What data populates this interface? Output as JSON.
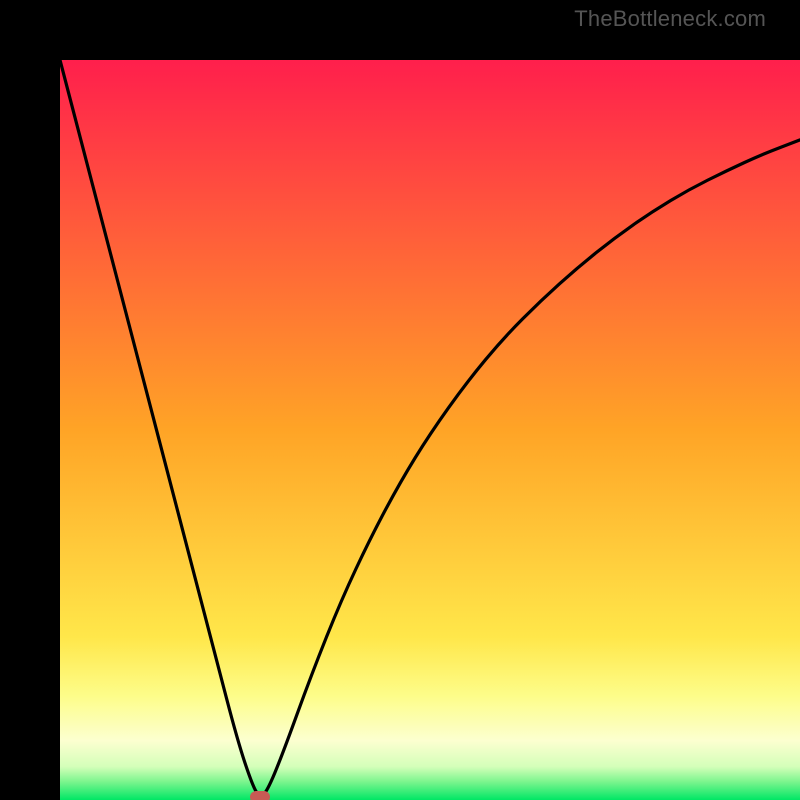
{
  "watermark": {
    "text": "TheBottleneck.com"
  },
  "chart_data": {
    "type": "line",
    "title": "",
    "xlabel": "",
    "ylabel": "",
    "xlim": [
      0,
      100
    ],
    "ylim": [
      0,
      100
    ],
    "grid": false,
    "legend": false,
    "background_gradient": {
      "stops": [
        {
          "pos": 0.0,
          "color": "#ff1f4c"
        },
        {
          "pos": 0.5,
          "color": "#ffa426"
        },
        {
          "pos": 0.78,
          "color": "#ffe74a"
        },
        {
          "pos": 0.86,
          "color": "#fdfd8a"
        },
        {
          "pos": 0.92,
          "color": "#fcffd0"
        },
        {
          "pos": 0.955,
          "color": "#d4ffb9"
        },
        {
          "pos": 0.975,
          "color": "#7df58e"
        },
        {
          "pos": 1.0,
          "color": "#00e765"
        }
      ]
    },
    "series": [
      {
        "name": "bottleneck-curve",
        "color": "#000000",
        "x": [
          0,
          3,
          6,
          9,
          12,
          15,
          18,
          21,
          24,
          26,
          27,
          28,
          30,
          34,
          38,
          42,
          46,
          50,
          55,
          60,
          65,
          70,
          75,
          80,
          85,
          90,
          95,
          100
        ],
        "y": [
          100,
          88.5,
          77,
          65.5,
          54,
          42.5,
          31,
          19.5,
          8,
          2,
          0.3,
          1.2,
          6,
          17,
          27,
          35.5,
          43,
          49.5,
          56.5,
          62.5,
          67.5,
          72,
          76,
          79.5,
          82.5,
          85,
          87.3,
          89.2
        ]
      }
    ],
    "marker": {
      "x": 27,
      "y": 0
    }
  }
}
